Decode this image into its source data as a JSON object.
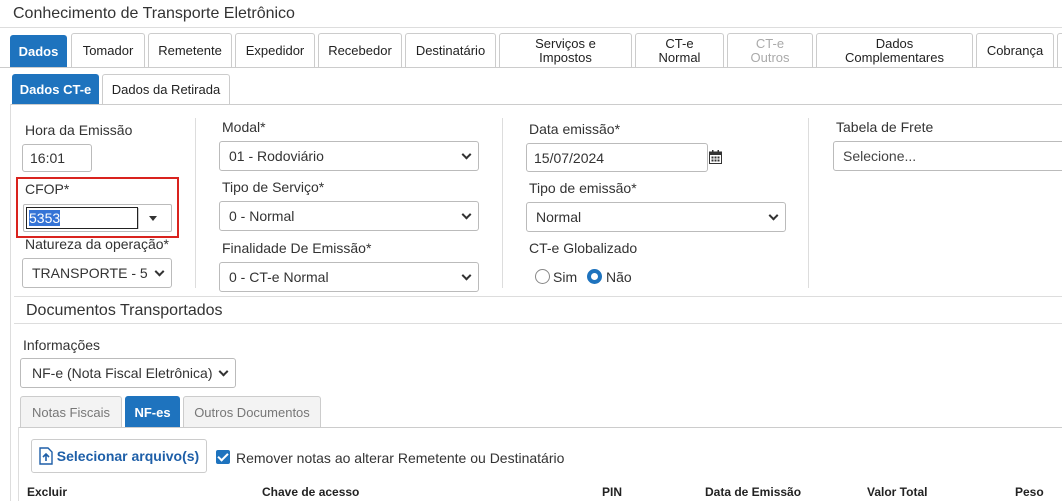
{
  "window": {
    "title": "Conhecimento de Transporte Eletrônico"
  },
  "tabs": [
    {
      "label": "Dados"
    },
    {
      "label": "Tomador"
    },
    {
      "label": "Remetente"
    },
    {
      "label": "Expedidor"
    },
    {
      "label": "Recebedor"
    },
    {
      "label": "Destinatário"
    },
    {
      "label": "Serviços e Impostos"
    },
    {
      "label": "CT-e Normal"
    },
    {
      "label": "CT-e Outros"
    },
    {
      "label": "Dados Complementares"
    },
    {
      "label": "Cobrança"
    }
  ],
  "subtabs": [
    {
      "label": "Dados CT-e"
    },
    {
      "label": "Dados da Retirada"
    }
  ],
  "form": {
    "hora_label": "Hora da Emissão",
    "hora_value": "16:01",
    "cfop_label": "CFOP*",
    "cfop_value": "5353",
    "natureza_label": "Natureza da operação*",
    "natureza_value": "TRANSPORTE - 5",
    "modal_label": "Modal*",
    "modal_value": "01 - Rodoviário",
    "tipo_servico_label": "Tipo de Serviço*",
    "tipo_servico_value": "0 - Normal",
    "finalidade_label": "Finalidade De Emissão*",
    "finalidade_value": "0 - CT-e Normal",
    "data_emissao_label": "Data emissão*",
    "data_emissao_value": "15/07/2024",
    "tipo_emissao_label": "Tipo de emissão*",
    "tipo_emissao_value": "Normal",
    "globalizado_label": "CT-e Globalizado",
    "globalizado_sim": "Sim",
    "globalizado_nao": "Não",
    "tabela_frete_label": "Tabela de Frete",
    "tabela_frete_value": "Selecione..."
  },
  "docs": {
    "section_title": "Documentos Transportados",
    "info_label": "Informações",
    "info_value": "NF-e (Nota Fiscal Eletrônica)",
    "tabs": [
      {
        "label": "Notas Fiscais"
      },
      {
        "label": "NF-es"
      },
      {
        "label": "Outros Documentos"
      }
    ],
    "select_file_label": "Selecionar arquivo(s)",
    "remove_notes_label": "Remover notas ao alterar Remetente ou Destinatário",
    "columns": [
      "Excluir",
      "Chave de acesso",
      "PIN",
      "Data de Emissão",
      "Valor Total",
      "Peso"
    ]
  },
  "colors": {
    "accent": "#1e73be",
    "highlight": "#d9231e"
  }
}
